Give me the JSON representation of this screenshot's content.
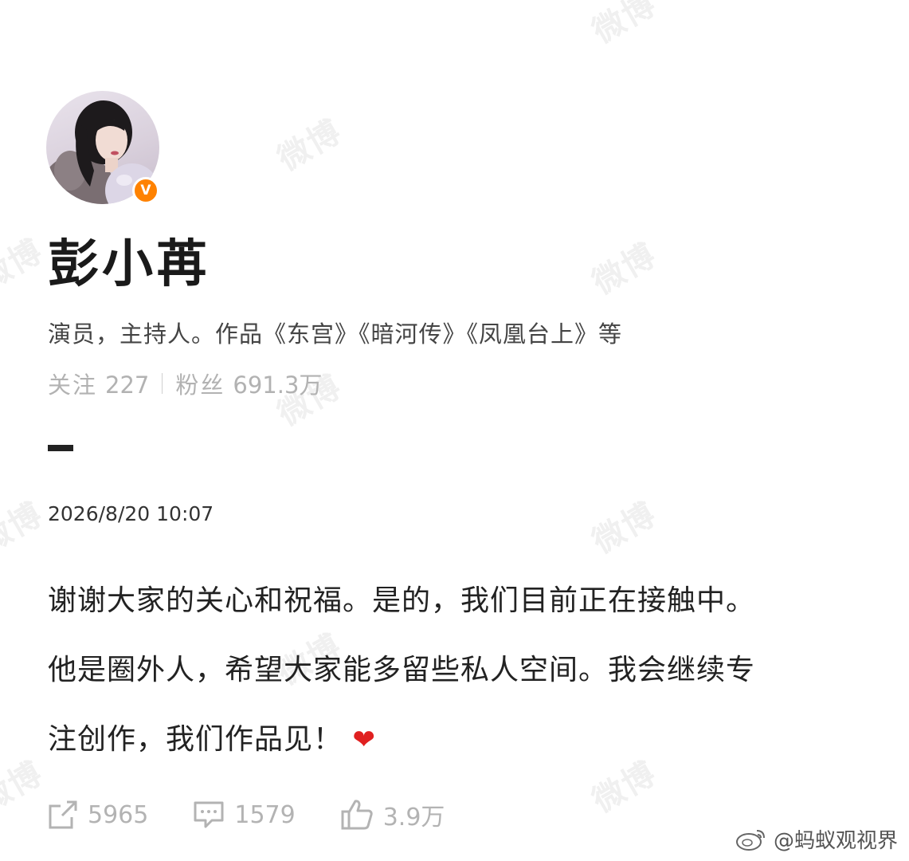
{
  "watermark": "微博",
  "profile": {
    "name": "彭小苒",
    "verified_badge": "V",
    "bio": "演员，主持人。作品《东宫》《暗河传》《凤凰台上》等",
    "following_label": "关注",
    "following_count": "227",
    "followers_label": "粉丝",
    "followers_count": "691.3万"
  },
  "post": {
    "timestamp": "2026/8/20 10:07",
    "lines": [
      "谢谢大家的关心和祝福。是的，我们目前正在接触中。",
      "他是圈外人，希望大家能多留些私人空间。我会继续专",
      "注创作，我们作品见！"
    ],
    "emoji": "❤"
  },
  "actions": {
    "reposts": "5965",
    "comments": "1579",
    "likes": "3.9万"
  },
  "credit": "@蚂蚁观视界",
  "colors": {
    "verified": "#ff8200",
    "muted": "#b3b3b3",
    "heart": "#e02020"
  }
}
